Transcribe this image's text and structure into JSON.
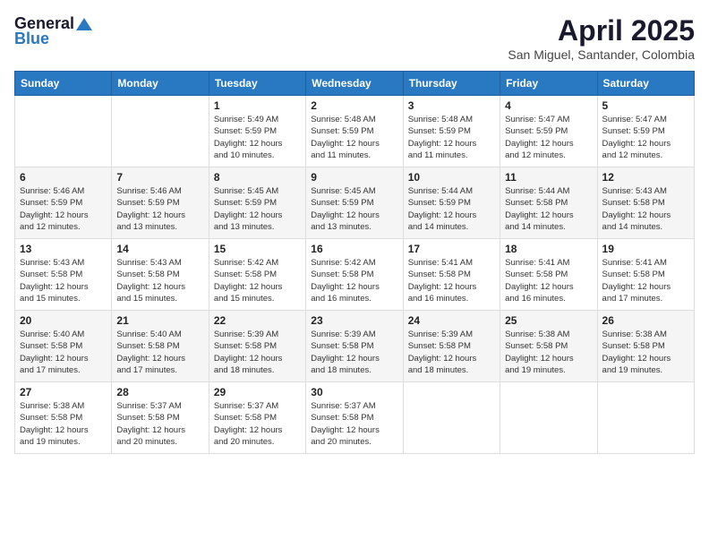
{
  "logo": {
    "general": "General",
    "blue": "Blue"
  },
  "title": "April 2025",
  "location": "San Miguel, Santander, Colombia",
  "days_of_week": [
    "Sunday",
    "Monday",
    "Tuesday",
    "Wednesday",
    "Thursday",
    "Friday",
    "Saturday"
  ],
  "weeks": [
    [
      {
        "day": "",
        "info": ""
      },
      {
        "day": "",
        "info": ""
      },
      {
        "day": "1",
        "info": "Sunrise: 5:49 AM\nSunset: 5:59 PM\nDaylight: 12 hours\nand 10 minutes."
      },
      {
        "day": "2",
        "info": "Sunrise: 5:48 AM\nSunset: 5:59 PM\nDaylight: 12 hours\nand 11 minutes."
      },
      {
        "day": "3",
        "info": "Sunrise: 5:48 AM\nSunset: 5:59 PM\nDaylight: 12 hours\nand 11 minutes."
      },
      {
        "day": "4",
        "info": "Sunrise: 5:47 AM\nSunset: 5:59 PM\nDaylight: 12 hours\nand 12 minutes."
      },
      {
        "day": "5",
        "info": "Sunrise: 5:47 AM\nSunset: 5:59 PM\nDaylight: 12 hours\nand 12 minutes."
      }
    ],
    [
      {
        "day": "6",
        "info": "Sunrise: 5:46 AM\nSunset: 5:59 PM\nDaylight: 12 hours\nand 12 minutes."
      },
      {
        "day": "7",
        "info": "Sunrise: 5:46 AM\nSunset: 5:59 PM\nDaylight: 12 hours\nand 13 minutes."
      },
      {
        "day": "8",
        "info": "Sunrise: 5:45 AM\nSunset: 5:59 PM\nDaylight: 12 hours\nand 13 minutes."
      },
      {
        "day": "9",
        "info": "Sunrise: 5:45 AM\nSunset: 5:59 PM\nDaylight: 12 hours\nand 13 minutes."
      },
      {
        "day": "10",
        "info": "Sunrise: 5:44 AM\nSunset: 5:59 PM\nDaylight: 12 hours\nand 14 minutes."
      },
      {
        "day": "11",
        "info": "Sunrise: 5:44 AM\nSunset: 5:58 PM\nDaylight: 12 hours\nand 14 minutes."
      },
      {
        "day": "12",
        "info": "Sunrise: 5:43 AM\nSunset: 5:58 PM\nDaylight: 12 hours\nand 14 minutes."
      }
    ],
    [
      {
        "day": "13",
        "info": "Sunrise: 5:43 AM\nSunset: 5:58 PM\nDaylight: 12 hours\nand 15 minutes."
      },
      {
        "day": "14",
        "info": "Sunrise: 5:43 AM\nSunset: 5:58 PM\nDaylight: 12 hours\nand 15 minutes."
      },
      {
        "day": "15",
        "info": "Sunrise: 5:42 AM\nSunset: 5:58 PM\nDaylight: 12 hours\nand 15 minutes."
      },
      {
        "day": "16",
        "info": "Sunrise: 5:42 AM\nSunset: 5:58 PM\nDaylight: 12 hours\nand 16 minutes."
      },
      {
        "day": "17",
        "info": "Sunrise: 5:41 AM\nSunset: 5:58 PM\nDaylight: 12 hours\nand 16 minutes."
      },
      {
        "day": "18",
        "info": "Sunrise: 5:41 AM\nSunset: 5:58 PM\nDaylight: 12 hours\nand 16 minutes."
      },
      {
        "day": "19",
        "info": "Sunrise: 5:41 AM\nSunset: 5:58 PM\nDaylight: 12 hours\nand 17 minutes."
      }
    ],
    [
      {
        "day": "20",
        "info": "Sunrise: 5:40 AM\nSunset: 5:58 PM\nDaylight: 12 hours\nand 17 minutes."
      },
      {
        "day": "21",
        "info": "Sunrise: 5:40 AM\nSunset: 5:58 PM\nDaylight: 12 hours\nand 17 minutes."
      },
      {
        "day": "22",
        "info": "Sunrise: 5:39 AM\nSunset: 5:58 PM\nDaylight: 12 hours\nand 18 minutes."
      },
      {
        "day": "23",
        "info": "Sunrise: 5:39 AM\nSunset: 5:58 PM\nDaylight: 12 hours\nand 18 minutes."
      },
      {
        "day": "24",
        "info": "Sunrise: 5:39 AM\nSunset: 5:58 PM\nDaylight: 12 hours\nand 18 minutes."
      },
      {
        "day": "25",
        "info": "Sunrise: 5:38 AM\nSunset: 5:58 PM\nDaylight: 12 hours\nand 19 minutes."
      },
      {
        "day": "26",
        "info": "Sunrise: 5:38 AM\nSunset: 5:58 PM\nDaylight: 12 hours\nand 19 minutes."
      }
    ],
    [
      {
        "day": "27",
        "info": "Sunrise: 5:38 AM\nSunset: 5:58 PM\nDaylight: 12 hours\nand 19 minutes."
      },
      {
        "day": "28",
        "info": "Sunrise: 5:37 AM\nSunset: 5:58 PM\nDaylight: 12 hours\nand 20 minutes."
      },
      {
        "day": "29",
        "info": "Sunrise: 5:37 AM\nSunset: 5:58 PM\nDaylight: 12 hours\nand 20 minutes."
      },
      {
        "day": "30",
        "info": "Sunrise: 5:37 AM\nSunset: 5:58 PM\nDaylight: 12 hours\nand 20 minutes."
      },
      {
        "day": "",
        "info": ""
      },
      {
        "day": "",
        "info": ""
      },
      {
        "day": "",
        "info": ""
      }
    ]
  ]
}
